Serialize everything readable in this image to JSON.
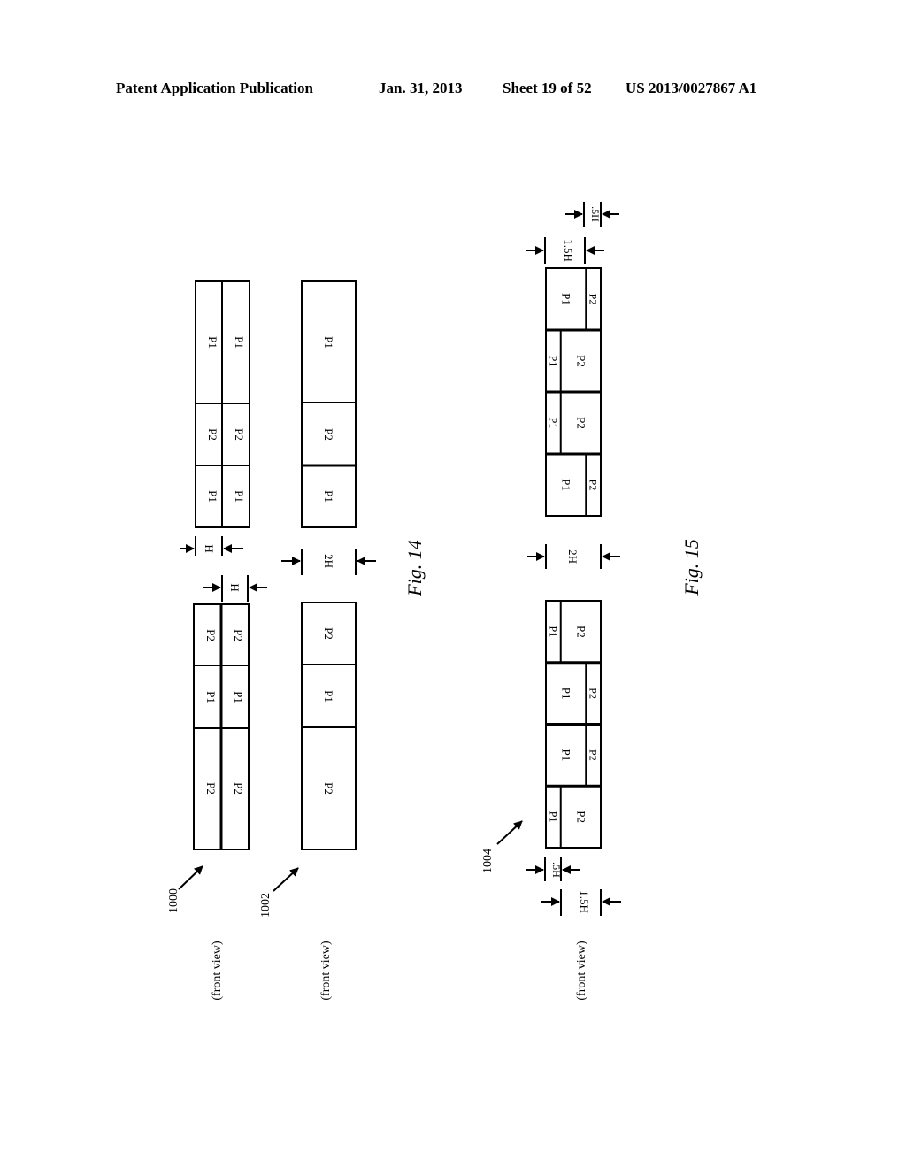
{
  "header": {
    "left": "Patent Application Publication",
    "date": "Jan. 31, 2013",
    "sheet": "Sheet 19 of 52",
    "number": "US 2013/0027867 A1"
  },
  "fig14": {
    "caption": "Fig. 14",
    "ref_1000": "1000",
    "ref_1002": "1002",
    "view_label_1": "(front view)",
    "view_label_2": "(front view)",
    "dim_H_top": "H",
    "dim_H_bottom": "H",
    "dim_2H": "2H",
    "arrangement_1000_upper": {
      "col1": [
        "P1",
        "P2",
        "P1"
      ],
      "col2": [
        "P1",
        "P2",
        "P1"
      ]
    },
    "arrangement_1000_lower": {
      "col1": [
        "P2",
        "P1",
        "P2"
      ],
      "col2": [
        "P2",
        "P1",
        "P2"
      ]
    },
    "arrangement_1002_upper": [
      "P1",
      "P2",
      "P1"
    ],
    "arrangement_1002_lower": [
      "P2",
      "P1",
      "P2"
    ]
  },
  "fig15": {
    "caption": "Fig. 15",
    "ref_1004": "1004",
    "view_label": "(front view)",
    "dim_1_5H_top": "1.5H",
    "dim_05H_top": ".5H",
    "dim_2H": "2H",
    "dim_05H_bottom": ".5H",
    "dim_1_5H_bottom": "1.5H",
    "upper_segments": [
      {
        "wide": "P1",
        "narrow": "P2",
        "narrow_side": "right"
      },
      {
        "wide": "P2",
        "narrow": "P1",
        "narrow_side": "left"
      },
      {
        "wide": "P2",
        "narrow": "P1",
        "narrow_side": "left"
      },
      {
        "wide": "P1",
        "narrow": "P2",
        "narrow_side": "right"
      }
    ],
    "lower_segments": [
      {
        "wide": "P2",
        "narrow": "P1",
        "narrow_side": "left"
      },
      {
        "wide": "P1",
        "narrow": "P2",
        "narrow_side": "right"
      },
      {
        "wide": "P1",
        "narrow": "P2",
        "narrow_side": "right"
      },
      {
        "wide": "P2",
        "narrow": "P1",
        "narrow_side": "left"
      }
    ]
  }
}
